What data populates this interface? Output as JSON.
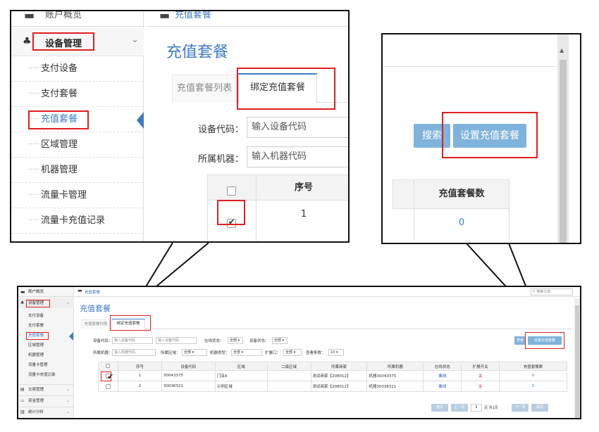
{
  "left_callout": {
    "top_item_partial": "账户概览",
    "top_breadcrumb_partial": "充值套餐",
    "group_label": "设备管理",
    "sidebar_items": [
      "支付设备",
      "支付套餐",
      "充值套餐",
      "区域管理",
      "机器管理",
      "流量卡管理",
      "流量卡充值记录"
    ],
    "page_title": "充值套餐",
    "tabs": [
      "充值套餐列表",
      "绑定充值套餐"
    ],
    "device_code_label": "设备代码：",
    "device_code_placeholder": "输入设备代码",
    "machine_label": "所属机器：",
    "machine_placeholder": "输入机器代码",
    "seq_header": "序号",
    "row_seq": "1"
  },
  "right_callout": {
    "search_label": "搜索",
    "set_button_label": "设置充值套餐",
    "count_header": "充值套餐数",
    "count_value": "0"
  },
  "main": {
    "sidebar": {
      "account": "账户概览",
      "group": "设备管理",
      "items": [
        "支付设备",
        "支付套餐",
        "充值套餐",
        "区域管理",
        "机器管理",
        "流量卡管理",
        "流量卡充值记录"
      ],
      "bottom_groups": [
        "交易管理",
        "资金管理",
        "统计分析"
      ]
    },
    "breadcrumb": "充值套餐",
    "search_placeholder": "搜索订单",
    "page_title": "充值套餐",
    "tabs": [
      "充值套餐列表",
      "绑定充值套餐"
    ],
    "filters": {
      "device_code_label": "设备代码：",
      "device_code_placeholder": "输入设备代码",
      "device_code_placeholder2": "输入设备代码",
      "online_label": "在线状态：",
      "online_value": "全部",
      "device_status_label": "设备状态：",
      "device_status_value": "全部",
      "machine_label": "所属机器：",
      "machine_placeholder": "输入机器代码",
      "region_label": "所属区域：",
      "region_value": "全部",
      "machine_type_label": "机器类型：",
      "machine_type_value": "全部",
      "port_label": "扩展口：",
      "port_value": "全部",
      "count_label": "查看条数：",
      "count_value": "10"
    },
    "search_label": "搜索",
    "set_button_label": "设置充值套餐",
    "table": {
      "headers": [
        "序号",
        "设备代码",
        "区域",
        "二级区域",
        "所属商家",
        "所属机器",
        "在线状态",
        "扩展开关",
        "充值套餐数"
      ],
      "rows": [
        {
          "seq": "1",
          "code": "30043375",
          "region": "门店A",
          "sub": "",
          "merchant": "测试商家【208012】",
          "machine": "机器30043375",
          "online": "离线",
          "switch": "关",
          "count": "0",
          "checked": true
        },
        {
          "seq": "2",
          "code": "30036321",
          "region": "示例区域",
          "sub": "",
          "merchant": "测试商家【208012】",
          "machine": "机器30036321",
          "online": "离线",
          "switch": "关",
          "count": "0",
          "checked": false
        }
      ]
    },
    "pagination": {
      "first": "首页",
      "prev": "上一页",
      "page": "1",
      "page_text": "页 共1页",
      "next": "下一页",
      "last": "尾页"
    }
  },
  "colors": {
    "accent_blue": "#3d7bc4",
    "button_blue": "#7fb3db",
    "highlight_red": "#e02020",
    "offline_blue": "#2255cc",
    "switch_red": "#e02020"
  }
}
